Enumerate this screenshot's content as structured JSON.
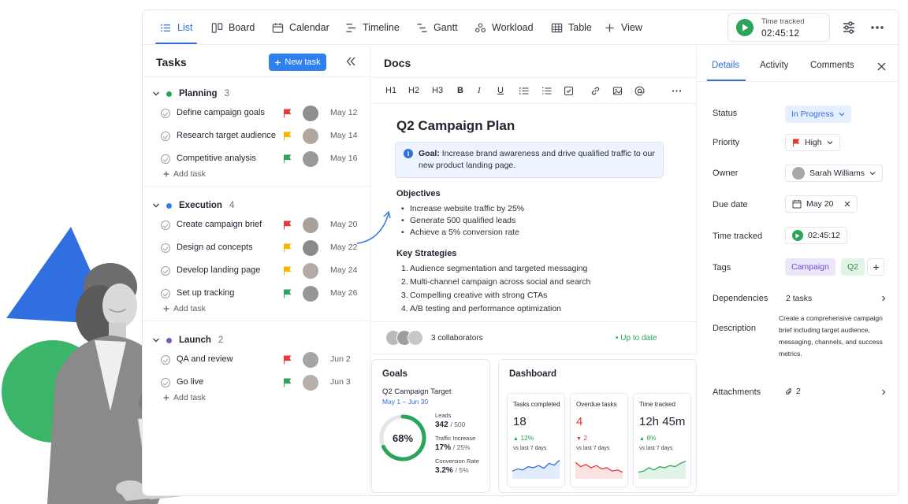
{
  "colors": {
    "accent": "#2f6fe0",
    "green": "#2aa55b",
    "red": "#e53935",
    "yellow": "#f5b800",
    "purple": "#7e57c2",
    "blue_dot": "#2f80ed"
  },
  "viewbar": {
    "tabs": [
      {
        "label": "List",
        "icon": "list-icon"
      },
      {
        "label": "Board",
        "icon": "board-icon"
      },
      {
        "label": "Calendar",
        "icon": "calendar-icon"
      },
      {
        "label": "Timeline",
        "icon": "timeline-icon"
      },
      {
        "label": "Gantt",
        "icon": "gantt-icon"
      },
      {
        "label": "Workload",
        "icon": "workload-icon"
      },
      {
        "label": "Table",
        "icon": "table-icon"
      },
      {
        "label": "View",
        "icon": "plus-icon"
      }
    ],
    "timer_label": "Time tracked",
    "timer_value": "02:45:12"
  },
  "tasks": {
    "title": "Tasks",
    "new_task": "New task",
    "add_task": "Add task",
    "groups": [
      {
        "name": "Planning",
        "count": "3",
        "color": "#2aa55b",
        "rows": [
          {
            "name": "Define campaign goals",
            "flag": "red",
            "date": "May 12"
          },
          {
            "name": "Research target audience",
            "flag": "yellow",
            "date": "May 14"
          },
          {
            "name": "Competitive analysis",
            "flag": "green",
            "date": "May 16"
          }
        ]
      },
      {
        "name": "Execution",
        "count": "4",
        "color": "#2f80ed",
        "rows": [
          {
            "name": "Create campaign brief",
            "flag": "red",
            "date": "May 20"
          },
          {
            "name": "Design ad concepts",
            "flag": "yellow",
            "date": "May 22"
          },
          {
            "name": "Develop landing page",
            "flag": "yellow",
            "date": "May 24"
          },
          {
            "name": "Set up tracking",
            "flag": "green",
            "date": "May 26"
          }
        ]
      },
      {
        "name": "Launch",
        "count": "2",
        "color": "#7e57c2",
        "rows": [
          {
            "name": "QA and review",
            "flag": "red",
            "date": "Jun 2"
          },
          {
            "name": "Go live",
            "flag": "green",
            "date": "Jun 3"
          }
        ]
      }
    ]
  },
  "docs": {
    "title": "Docs",
    "toolbar": [
      "H1",
      "H2",
      "H3",
      "B",
      "I",
      "U"
    ],
    "heading": "Q2 Campaign Plan",
    "goal_label": "Goal:",
    "goal_text": "Increase brand awareness and drive qualified traffic to our new product landing page.",
    "objectives_title": "Objectives",
    "objectives": [
      "Increase website traffic by 25%",
      "Generate 500 qualified leads",
      "Achieve a 5% conversion rate"
    ],
    "strategies_title": "Key Strategies",
    "strategies": [
      "Audience segmentation and targeted messaging",
      "Multi-channel campaign across social and search",
      "Compelling creative with strong CTAs",
      "A/B testing and performance optimization"
    ],
    "collaborators": "3 collaborators",
    "status": "Up to date"
  },
  "goals": {
    "title": "Goals",
    "name": "Q2 Campaign Target",
    "range": "May 1 – Jun 30",
    "progress": 0.68,
    "progress_label": "68%",
    "kpis": [
      {
        "label": "Leads",
        "value": "342",
        "target": "/ 500"
      },
      {
        "label": "Traffic Increase",
        "value": "17%",
        "target": "/ 25%"
      },
      {
        "label": "Conversion Rate",
        "value": "3.2%",
        "target": "/ 5%"
      }
    ]
  },
  "dashboard": {
    "title": "Dashboard",
    "stats": [
      {
        "label": "Tasks completed",
        "value": "18",
        "change": "12%",
        "dir": "up",
        "sub": "vs last 7 days",
        "color": "#2aa55b",
        "spark": [
          0.35,
          0.45,
          0.4,
          0.55,
          0.5,
          0.6,
          0.48,
          0.7,
          0.62,
          0.85
        ]
      },
      {
        "label": "Overdue tasks",
        "value": "4",
        "change": "2",
        "dir": "down",
        "sub": "vs last 7 days",
        "color": "#e53935",
        "spark": [
          0.75,
          0.55,
          0.65,
          0.5,
          0.6,
          0.45,
          0.5,
          0.35,
          0.4,
          0.3
        ]
      },
      {
        "label": "Time tracked",
        "value": "12h 45m",
        "change": "8%",
        "dir": "up",
        "sub": "vs last 7 days",
        "color": "#2aa55b",
        "spark": [
          0.3,
          0.35,
          0.5,
          0.4,
          0.55,
          0.5,
          0.6,
          0.55,
          0.7,
          0.8
        ]
      }
    ]
  },
  "details": {
    "tabs": [
      "Details",
      "Activity",
      "Comments"
    ],
    "labels": {
      "status": "Status",
      "priority": "Priority",
      "owner": "Owner",
      "due": "Due date",
      "time": "Time tracked",
      "tags": "Tags",
      "deps": "Dependencies",
      "desc": "Description",
      "attach": "Attachments"
    },
    "status": "In Progress",
    "priority": "High",
    "owner": "Sarah Williams",
    "due": "May 20",
    "time": "02:45:12",
    "tags": [
      "Campaign",
      "Q2"
    ],
    "deps": "2 tasks",
    "description": "Create a comprehensive campaign brief including target audience, messaging, channels, and success metrics.",
    "attachments": "2"
  }
}
